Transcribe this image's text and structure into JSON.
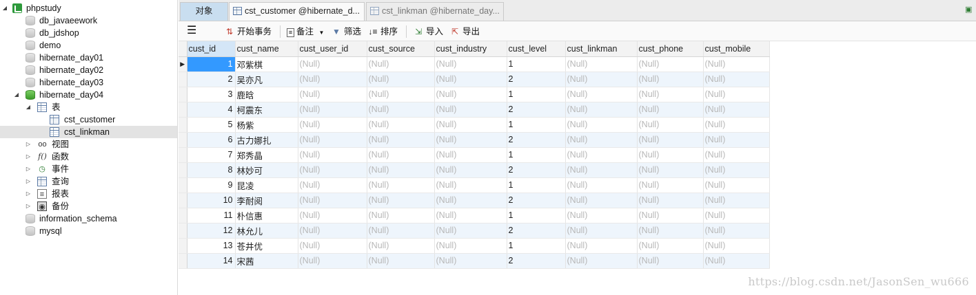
{
  "tree": {
    "items": [
      {
        "label": "phpstudy",
        "icon": "server-icon"
      },
      {
        "label": "db_javaeework",
        "icon": "database-icon"
      },
      {
        "label": "db_jdshop",
        "icon": "database-icon"
      },
      {
        "label": "demo",
        "icon": "database-icon"
      },
      {
        "label": "hibernate_day01",
        "icon": "database-icon"
      },
      {
        "label": "hibernate_day02",
        "icon": "database-icon"
      },
      {
        "label": "hibernate_day03",
        "icon": "database-icon"
      },
      {
        "label": "hibernate_day04",
        "icon": "database-open-icon"
      },
      {
        "label": "表",
        "icon": "tables-icon"
      },
      {
        "label": "cst_customer",
        "icon": "table-icon"
      },
      {
        "label": "cst_linkman",
        "icon": "table-icon"
      },
      {
        "label": "视图",
        "icon": "views-icon"
      },
      {
        "label": "函数",
        "icon": "function-icon"
      },
      {
        "label": "事件",
        "icon": "event-icon"
      },
      {
        "label": "查询",
        "icon": "query-icon"
      },
      {
        "label": "报表",
        "icon": "report-icon"
      },
      {
        "label": "备份",
        "icon": "backup-icon"
      },
      {
        "label": "information_schema",
        "icon": "database-icon"
      },
      {
        "label": "mysql",
        "icon": "database-icon"
      }
    ],
    "selected": "cst_linkman"
  },
  "tabs": {
    "objects": "对象",
    "t1": "cst_customer @hibernate_d...",
    "t2": "cst_linkman @hibernate_day..."
  },
  "toolbar": {
    "begin_tx": "开始事务",
    "memo": "备注",
    "filter": "筛选",
    "sort": "排序",
    "import": "导入",
    "export": "导出"
  },
  "grid": {
    "columns": [
      "cust_id",
      "cust_name",
      "cust_user_id",
      "cust_source",
      "cust_industry",
      "cust_level",
      "cust_linkman",
      "cust_phone",
      "cust_mobile"
    ],
    "null_text": "(Null)",
    "rows": [
      [
        "1",
        "邓紫棋",
        "(Null)",
        "(Null)",
        "(Null)",
        "1",
        "(Null)",
        "(Null)",
        "(Null)"
      ],
      [
        "2",
        "吴亦凡",
        "(Null)",
        "(Null)",
        "(Null)",
        "2",
        "(Null)",
        "(Null)",
        "(Null)"
      ],
      [
        "3",
        "鹿晗",
        "(Null)",
        "(Null)",
        "(Null)",
        "1",
        "(Null)",
        "(Null)",
        "(Null)"
      ],
      [
        "4",
        "柯震东",
        "(Null)",
        "(Null)",
        "(Null)",
        "2",
        "(Null)",
        "(Null)",
        "(Null)"
      ],
      [
        "5",
        "杨紫",
        "(Null)",
        "(Null)",
        "(Null)",
        "1",
        "(Null)",
        "(Null)",
        "(Null)"
      ],
      [
        "6",
        "古力娜扎",
        "(Null)",
        "(Null)",
        "(Null)",
        "2",
        "(Null)",
        "(Null)",
        "(Null)"
      ],
      [
        "7",
        "郑秀晶",
        "(Null)",
        "(Null)",
        "(Null)",
        "1",
        "(Null)",
        "(Null)",
        "(Null)"
      ],
      [
        "8",
        "林妙可",
        "(Null)",
        "(Null)",
        "(Null)",
        "2",
        "(Null)",
        "(Null)",
        "(Null)"
      ],
      [
        "9",
        "昆凌",
        "(Null)",
        "(Null)",
        "(Null)",
        "1",
        "(Null)",
        "(Null)",
        "(Null)"
      ],
      [
        "10",
        "李耐阅",
        "(Null)",
        "(Null)",
        "(Null)",
        "2",
        "(Null)",
        "(Null)",
        "(Null)"
      ],
      [
        "11",
        "朴信惠",
        "(Null)",
        "(Null)",
        "(Null)",
        "1",
        "(Null)",
        "(Null)",
        "(Null)"
      ],
      [
        "12",
        "林允儿",
        "(Null)",
        "(Null)",
        "(Null)",
        "2",
        "(Null)",
        "(Null)",
        "(Null)"
      ],
      [
        "13",
        "苍井优",
        "(Null)",
        "(Null)",
        "(Null)",
        "1",
        "(Null)",
        "(Null)",
        "(Null)"
      ],
      [
        "14",
        "宋茜",
        "(Null)",
        "(Null)",
        "(Null)",
        "2",
        "(Null)",
        "(Null)",
        "(Null)"
      ]
    ]
  },
  "watermark": "https://blog.csdn.net/JasonSen_wu666",
  "colors": {
    "selection": "#3399ff",
    "active_tab": "#c9def0",
    "alt_row": "#eef5fc"
  }
}
